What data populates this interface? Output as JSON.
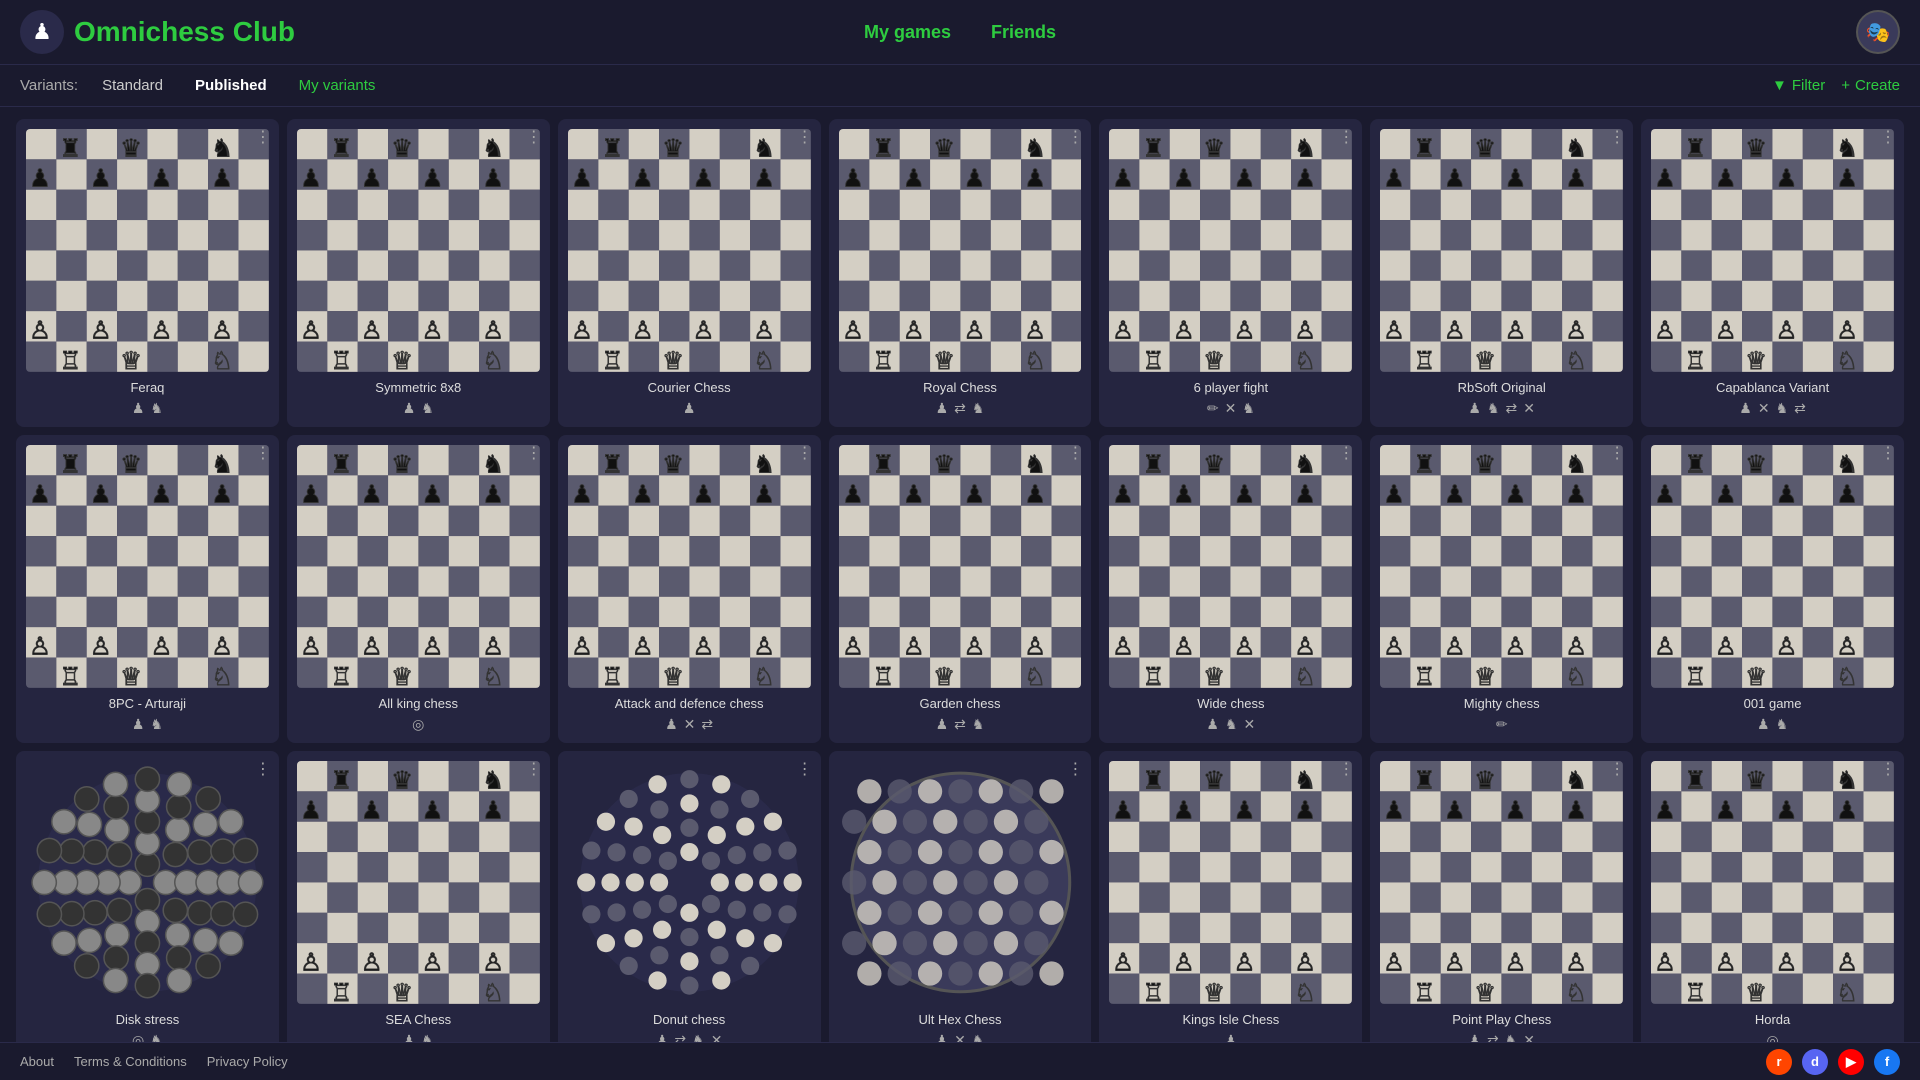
{
  "header": {
    "logo_text": "Omnichess Club",
    "nav_items": [
      "My games",
      "Friends"
    ],
    "logo_icon": "♟"
  },
  "tabs": {
    "label": "Variants:",
    "items": [
      "Standard",
      "Published",
      "My variants"
    ],
    "active": "Published",
    "filter_label": "Filter",
    "create_label": "Create"
  },
  "cards": [
    {
      "title": "Feraq",
      "icons": [
        "♟",
        "♞"
      ]
    },
    {
      "title": "Symmetric 8x8",
      "icons": [
        "♟",
        "♞"
      ]
    },
    {
      "title": "Courier Chess",
      "icons": [
        "♟"
      ]
    },
    {
      "title": "Royal Chess",
      "icons": [
        "♟",
        "⇄",
        "♞"
      ]
    },
    {
      "title": "6 player fight",
      "icons": [
        "✏",
        "✕",
        "♞"
      ]
    },
    {
      "title": "RbSoft Original",
      "icons": [
        "♟",
        "♞",
        "⇄",
        "✕"
      ]
    },
    {
      "title": "Capablanca Variant",
      "icons": [
        "♟",
        "✕",
        "♞",
        "⇄"
      ]
    },
    {
      "title": "8PC - Arturaji",
      "icons": [
        "♟",
        "♞"
      ]
    },
    {
      "title": "All king chess",
      "icons": [
        "◎"
      ]
    },
    {
      "title": "Attack and defence chess",
      "icons": [
        "♟",
        "✕",
        "⇄"
      ]
    },
    {
      "title": "Garden chess",
      "icons": [
        "♟",
        "⇄",
        "♞"
      ]
    },
    {
      "title": "Wide chess",
      "icons": [
        "♟",
        "♞",
        "✕"
      ]
    },
    {
      "title": "Mighty chess",
      "icons": [
        "✏"
      ]
    },
    {
      "title": "001 game",
      "icons": [
        "♟",
        "♞"
      ]
    },
    {
      "title": "Disk stress",
      "icons": [
        "◎",
        "♞"
      ]
    },
    {
      "title": "SEA Chess",
      "icons": [
        "♟",
        "♞"
      ]
    },
    {
      "title": "Donut chess",
      "icons": [
        "♟",
        "⇄",
        "♞",
        "✕"
      ]
    },
    {
      "title": "Ult Hex Chess",
      "icons": [
        "♟",
        "✕",
        "♞"
      ]
    },
    {
      "title": "Kings Isle Chess",
      "icons": [
        "♟"
      ]
    },
    {
      "title": "Point Play Chess",
      "icons": [
        "♟",
        "⇄",
        "♞",
        "✕"
      ]
    },
    {
      "title": "Horda",
      "icons": [
        "◎"
      ]
    }
  ],
  "footer": {
    "links": [
      "About",
      "Terms & Conditions",
      "Privacy Policy"
    ],
    "social": [
      {
        "name": "reddit",
        "label": "r"
      },
      {
        "name": "discord",
        "label": "d"
      },
      {
        "name": "youtube",
        "label": "▶"
      },
      {
        "name": "facebook",
        "label": "f"
      }
    ]
  }
}
